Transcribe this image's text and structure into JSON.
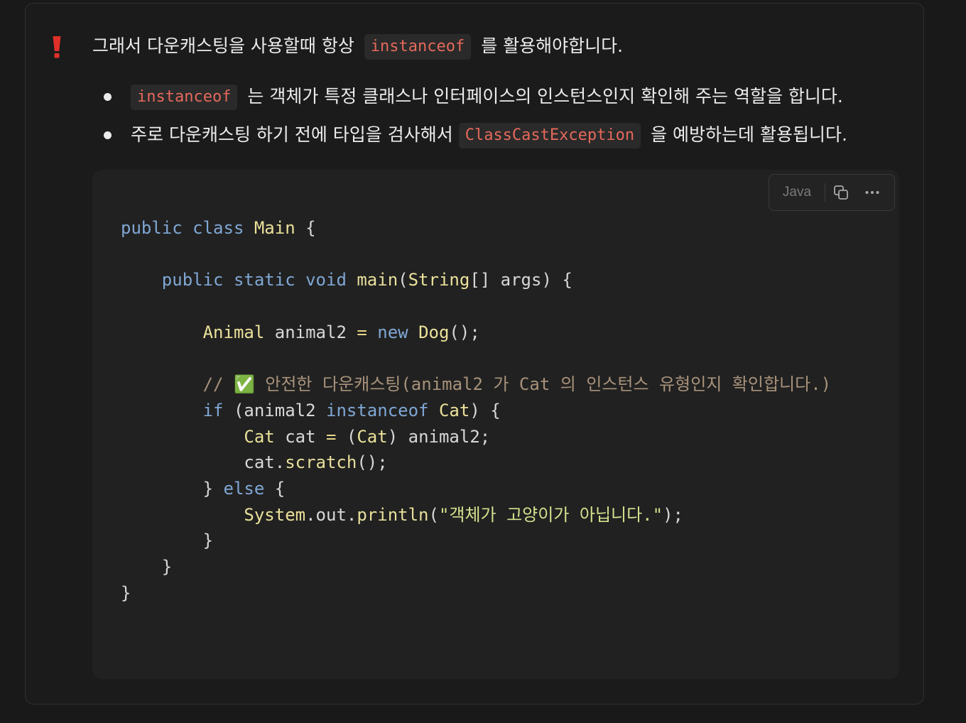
{
  "callout": {
    "icon": "exclamation-icon",
    "accent_color": "#e0302a",
    "heading_before": "그래서 다운캐스팅을 사용할때 항상",
    "heading_code": "instanceof",
    "heading_after": "를 활용해야합니다."
  },
  "bullets": [
    {
      "before": "",
      "code": "instanceof",
      "after": "는 객체가 특정 클래스나 인터페이스의 인스턴스인지 확인해 주는 역할을 합니다."
    },
    {
      "before": "주로 다운캐스팅 하기 전에 타입을 검사해서",
      "code": "ClassCastException",
      "after": "을 예방하는데 활용됩니다."
    }
  ],
  "code_block": {
    "language": "Java",
    "copy_icon": "copy-icon",
    "more_icon": "more-options-icon",
    "lines": [
      [
        [
          "kw",
          "public"
        ],
        [
          "t",
          " "
        ],
        [
          "kw",
          "class"
        ],
        [
          "t",
          " "
        ],
        [
          "type",
          "Main"
        ],
        [
          "t",
          " {"
        ]
      ],
      [],
      [
        [
          "t",
          "    "
        ],
        [
          "kw",
          "public"
        ],
        [
          "t",
          " "
        ],
        [
          "kw",
          "static"
        ],
        [
          "t",
          " "
        ],
        [
          "kw",
          "void"
        ],
        [
          "t",
          " "
        ],
        [
          "fn",
          "main"
        ],
        [
          "t",
          "("
        ],
        [
          "type",
          "String"
        ],
        [
          "t",
          "[] args) {"
        ]
      ],
      [],
      [
        [
          "t",
          "        "
        ],
        [
          "type",
          "Animal"
        ],
        [
          "t",
          " animal2 "
        ],
        [
          "op",
          "="
        ],
        [
          "t",
          " "
        ],
        [
          "kw",
          "new"
        ],
        [
          "t",
          " "
        ],
        [
          "type",
          "Dog"
        ],
        [
          "t",
          "();"
        ]
      ],
      [],
      [
        [
          "t",
          "        "
        ],
        [
          "cmt",
          "// ✅ 안전한 다운캐스팅(animal2 가 Cat 의 인스턴스 유형인지 확인합니다.)"
        ]
      ],
      [
        [
          "t",
          "        "
        ],
        [
          "kw",
          "if"
        ],
        [
          "t",
          " (animal2 "
        ],
        [
          "kw",
          "instanceof"
        ],
        [
          "t",
          " "
        ],
        [
          "type",
          "Cat"
        ],
        [
          "t",
          ") {"
        ]
      ],
      [
        [
          "t",
          "            "
        ],
        [
          "type",
          "Cat"
        ],
        [
          "t",
          " cat "
        ],
        [
          "op",
          "="
        ],
        [
          "t",
          " ("
        ],
        [
          "type",
          "Cat"
        ],
        [
          "t",
          ") animal2;"
        ]
      ],
      [
        [
          "t",
          "            cat."
        ],
        [
          "fn",
          "scratch"
        ],
        [
          "t",
          "();"
        ]
      ],
      [
        [
          "t",
          "        } "
        ],
        [
          "kw",
          "else"
        ],
        [
          "t",
          " {"
        ]
      ],
      [
        [
          "t",
          "            "
        ],
        [
          "type",
          "System"
        ],
        [
          "t",
          ".out."
        ],
        [
          "fn",
          "println"
        ],
        [
          "t",
          "("
        ],
        [
          "str",
          "\"객체가 고양이가 아닙니다.\""
        ],
        [
          "t",
          ");"
        ]
      ],
      [
        [
          "t",
          "        }"
        ]
      ],
      [
        [
          "t",
          "    }"
        ]
      ],
      [
        [
          "t",
          "}"
        ]
      ]
    ]
  }
}
